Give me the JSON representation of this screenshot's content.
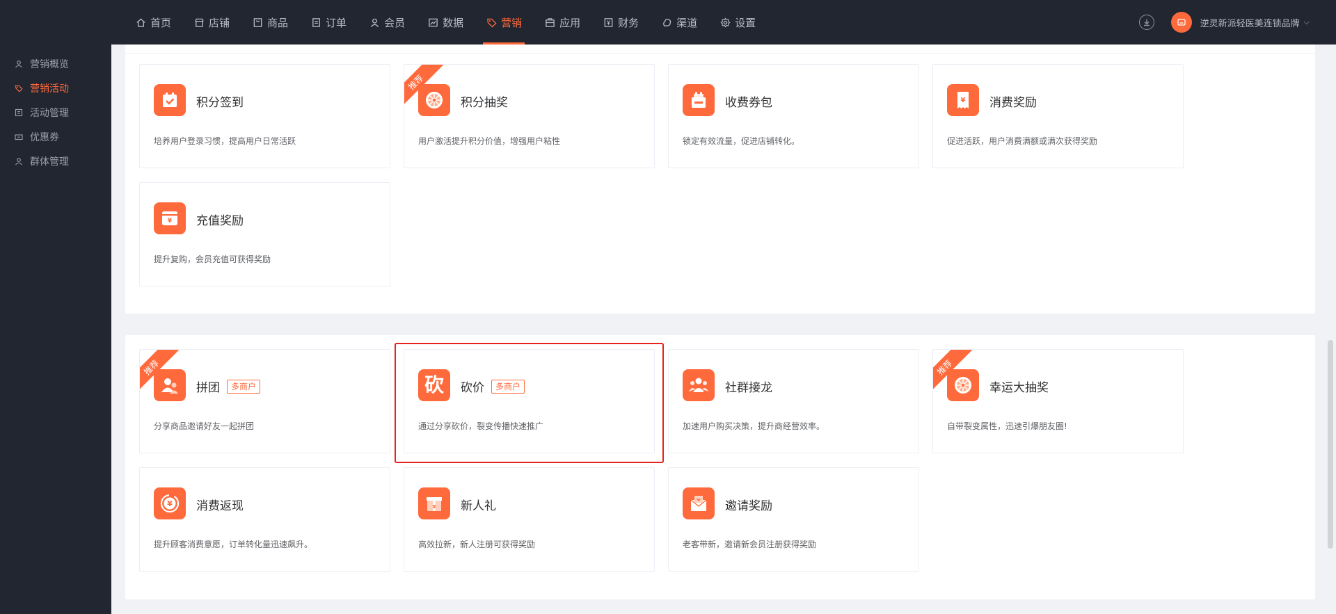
{
  "topnav": {
    "items": [
      {
        "label": "首页",
        "icon": "home-icon"
      },
      {
        "label": "店铺",
        "icon": "shop-icon"
      },
      {
        "label": "商品",
        "icon": "goods-icon"
      },
      {
        "label": "订单",
        "icon": "order-icon"
      },
      {
        "label": "会员",
        "icon": "member-icon"
      },
      {
        "label": "数据",
        "icon": "chart-icon"
      },
      {
        "label": "营销",
        "icon": "tag-icon",
        "active": true
      },
      {
        "label": "应用",
        "icon": "app-icon"
      },
      {
        "label": "财务",
        "icon": "finance-icon"
      },
      {
        "label": "渠道",
        "icon": "channel-icon"
      },
      {
        "label": "设置",
        "icon": "gear-icon"
      }
    ],
    "shop_name": "逆灵新派轻医美连锁品牌"
  },
  "sidebar": {
    "items": [
      {
        "label": "营销概览"
      },
      {
        "label": "营销活动",
        "active": true
      },
      {
        "label": "活动管理"
      },
      {
        "label": "优惠券"
      },
      {
        "label": "群体管理"
      }
    ]
  },
  "colors": {
    "accent": "#ff6a3c",
    "nav_bg": "#222630",
    "highlight": "#e5221b"
  },
  "section1": {
    "cards": [
      {
        "title": "积分签到",
        "desc": "培养用户登录习惯，提高用户日常活跃",
        "icon": "calendar-check-icon"
      },
      {
        "title": "积分抽奖",
        "desc": "用户激活提升积分价值，增强用户粘性",
        "icon": "wheel-icon",
        "ribbon": "推荐"
      },
      {
        "title": "收费券包",
        "desc": "锁定有效流量，促进店铺转化。",
        "icon": "coupon-bag-icon"
      },
      {
        "title": "消费奖励",
        "desc": "促进活跃，用户消费满额或满次获得奖励",
        "icon": "receipt-yen-icon"
      },
      {
        "title": "充值奖励",
        "desc": "提升复购，会员充值可获得奖励",
        "icon": "wallet-yen-icon"
      }
    ]
  },
  "section2": {
    "cards": [
      {
        "title": "拼团",
        "tag": "多商户",
        "desc": "分享商品邀请好友一起拼团",
        "icon": "group-users-icon",
        "ribbon": "推荐"
      },
      {
        "title": "砍价",
        "tag": "多商户",
        "desc": "通过分享砍价，裂变传播快速推广",
        "icon": "bargain-icon",
        "glyph": "砍"
      },
      {
        "title": "社群接龙",
        "desc": "加速用户购买决策，提升商经营效率。",
        "icon": "community-icon"
      },
      {
        "title": "幸运大抽奖",
        "desc": "自带裂变属性，迅速引爆朋友圈!",
        "icon": "lucky-wheel-icon",
        "ribbon": "推荐"
      },
      {
        "title": "消费返现",
        "desc": "提升顾客消费意愿，订单转化量迅速飙升。",
        "icon": "cashback-yen-icon"
      },
      {
        "title": "新人礼",
        "desc": "高效拉新，新人注册可获得奖励",
        "icon": "gift-icon"
      },
      {
        "title": "邀请奖励",
        "desc": "老客带新，邀请新会员注册获得奖励",
        "icon": "invite-envelope-icon"
      }
    ]
  }
}
